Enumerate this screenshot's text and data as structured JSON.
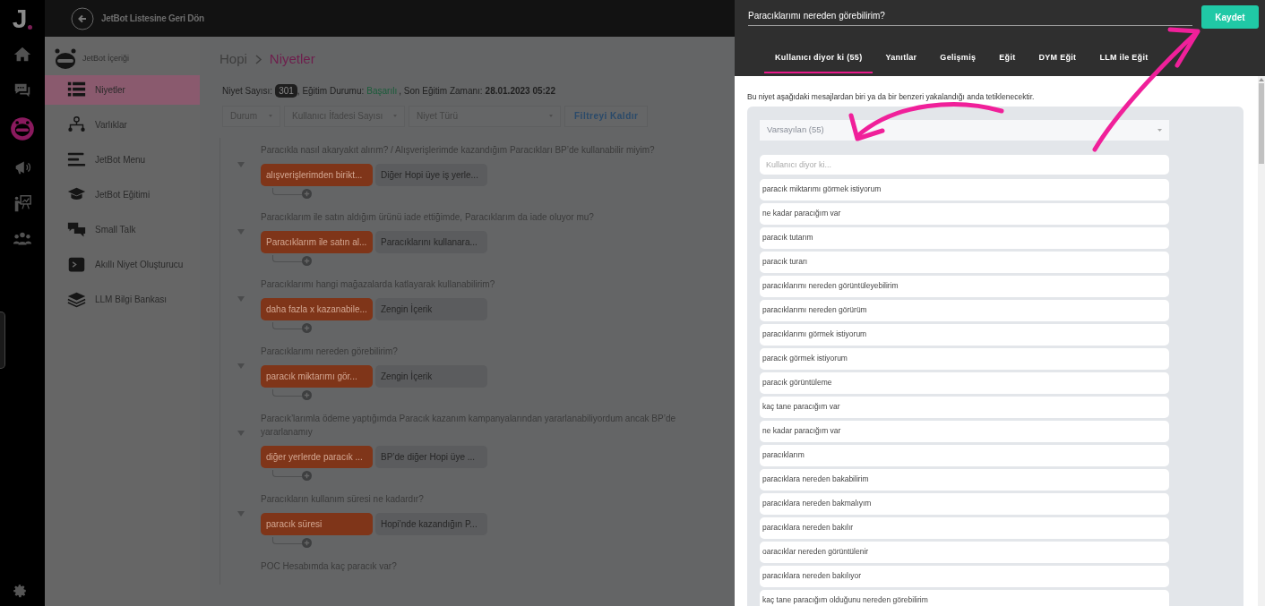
{
  "logo": "J",
  "top_bar": {
    "back_label": "JetBot Listesine Geri Dön"
  },
  "rail": {
    "items": [
      {
        "kind": "home",
        "selected": false
      },
      {
        "kind": "chat",
        "selected": false
      },
      {
        "kind": "bot",
        "selected": true
      },
      {
        "kind": "megaphone",
        "selected": false
      },
      {
        "kind": "teacher",
        "selected": false
      },
      {
        "kind": "group",
        "selected": false
      }
    ]
  },
  "sidebar": {
    "header": "JetBot İçeriği",
    "items": [
      {
        "label": "Niyetler",
        "kind": "list",
        "selected": true
      },
      {
        "label": "Varlıklar",
        "kind": "tree",
        "selected": false
      },
      {
        "label": "JetBot Menu",
        "kind": "menu",
        "selected": false
      },
      {
        "label": "JetBot Eğitimi",
        "kind": "cap",
        "selected": false
      },
      {
        "label": "Small Talk",
        "kind": "bubbles",
        "selected": false
      },
      {
        "label": "Akıllı Niyet Oluşturucu",
        "kind": "terminal",
        "selected": false
      },
      {
        "label": "LLM Bilgi Bankası",
        "kind": "layers",
        "selected": false
      }
    ]
  },
  "breadcrumb": [
    "Hopi",
    "Niyetler"
  ],
  "stats": {
    "count_label": "Niyet Sayısı:",
    "count": "301",
    "status_label": ", Eğitim Durumu:",
    "status": "Başarılı",
    "last_label": ", Son Eğitim Zamanı:",
    "last": "28.01.2023 05:22"
  },
  "filters": [
    {
      "placeholder": "Durum"
    },
    {
      "placeholder": "Kullanıcı İfadesi Sayısı"
    },
    {
      "placeholder": "Niyet Türü"
    }
  ],
  "clear_filter": "Filtreyi Kaldır",
  "intents": [
    {
      "question": "Paracıkla nasıl akaryakıt alırım? / Alışverişlerimde kazandığım Paracıkları BP’de kullanabilir miyim?",
      "pills": [
        {
          "text": "alışverişlerimden birikt...",
          "kind": "expression"
        },
        {
          "text": "Diğer Hopi üye iş yerle...",
          "kind": "response"
        }
      ]
    },
    {
      "question": "Paracıklarım ile satın aldığım ürünü iade ettiğimde, Paracıklarım da iade oluyor mu?",
      "pills": [
        {
          "text": "Paracıklarım ile satın al...",
          "kind": "expression"
        },
        {
          "text": "Paracıklarını kullanara...",
          "kind": "response"
        }
      ]
    },
    {
      "question": "Paracıklarımı hangi mağazalarda katlayarak kullanabilirim?",
      "pills": [
        {
          "text": "daha fazla x kazanabile...",
          "kind": "expression"
        },
        {
          "text": "Zengin İçerik",
          "kind": "response"
        }
      ]
    },
    {
      "question": "Paracıklarımı nereden görebilirim?",
      "pills": [
        {
          "text": "paracık miktarımı gör...",
          "kind": "expression"
        },
        {
          "text": "Zengin İçerik",
          "kind": "response"
        }
      ]
    },
    {
      "question": "Paracık’larımla ödeme yaptığımda Paracık kazanım kampanyalarından yararlanabiliyordum ancak BP’de yararlanamıy",
      "pills": [
        {
          "text": "diğer yerlerde paracık ...",
          "kind": "expression"
        },
        {
          "text": "BP’de diğer Hopi üye ...",
          "kind": "response"
        }
      ]
    },
    {
      "question": "Paracıkların kullanım süresi ne kadardır?",
      "pills": [
        {
          "text": "paracık süresi",
          "kind": "expression"
        },
        {
          "text": "Hopi’nde kazandığın P...",
          "kind": "response"
        }
      ]
    },
    {
      "question": "POC Hesabımda kaç paracık var?"
    }
  ],
  "panel": {
    "title": "Paracıklarımı nereden görebilirim?",
    "save": "Kaydet",
    "tabs": [
      {
        "label": "Kullanıcı diyor ki (55)",
        "selected": true
      },
      {
        "label": "Yanıtlar",
        "selected": false
      },
      {
        "label": "Gelişmiş",
        "selected": false
      },
      {
        "label": "Eğit",
        "selected": false
      },
      {
        "label": "DYM Eğit",
        "selected": false
      },
      {
        "label": "LLM ile Eğit",
        "selected": false
      }
    ],
    "description": "Bu niyet aşağıdaki mesajlardan biri ya da bir benzeri yakalandığı anda tetiklenecektir.",
    "group_select": "Varsayılan (55)",
    "input_placeholder": "Kullanıcı diyor ki...",
    "utterances": [
      "paracık miktarımı görmek istiyorum",
      "ne kadar paracığım var",
      "paracık tutarım",
      "paracık turarı",
      "paracıklarımı nereden görüntüleyebilirim",
      "paracıklarımı nereden görürüm",
      "paracıklarımı görmek istiyorum",
      "paracık görmek istiyorum",
      "paracık görüntüleme",
      "kaç tane paracığım var",
      "ne kadar paracığım var",
      "paracıklarım",
      "paracıklara nereden bakabilirim",
      "paracıklara nereden bakmalıyım",
      "paracıklara nereden bakılır",
      "oaracıklar nereden görüntülenir",
      "paracıklara nereden bakılıyor",
      "kaç tane paracığım olduğunu nereden görebilirim"
    ]
  }
}
